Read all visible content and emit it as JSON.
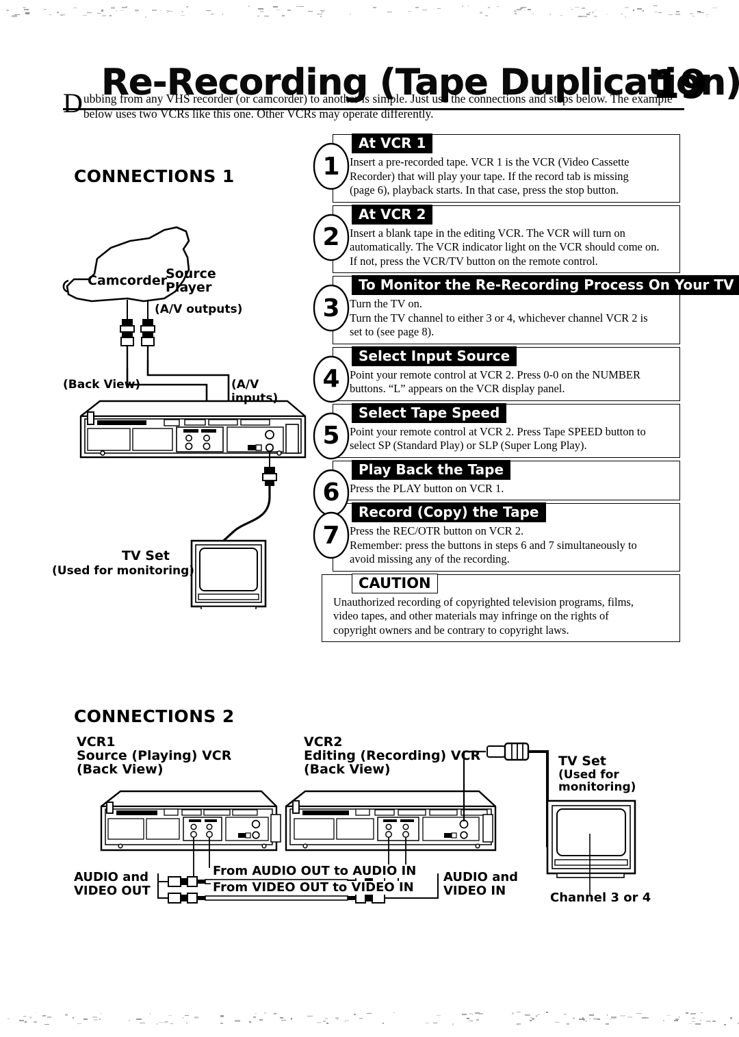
{
  "header": {
    "title": "Re-Recording (Tape Duplication)",
    "page_number": "19"
  },
  "intro": {
    "dropcap": "D",
    "text": "ubbing from any VHS recorder (or camcorder) to another is simple. Just use the connections and steps below. The example below uses two VCRs like this one. Other VCRs may operate differently."
  },
  "sections": {
    "connections1_title": "CONNECTIONS 1",
    "connections2_title": "CONNECTIONS 2"
  },
  "steps": [
    {
      "number": "1",
      "heading": "At VCR 1",
      "lines": [
        "Insert a pre-recorded tape. VCR 1 is the VCR (Video Cassette",
        "Recorder) that will play your tape. If the record tab is missing",
        "(page 6), playback starts. In that case, press the stop button."
      ]
    },
    {
      "number": "2",
      "heading": "At VCR 2",
      "lines": [
        "Insert a blank tape in the editing VCR. The VCR will turn on",
        "automatically. The VCR indicator light on the VCR should come on.",
        "If not, press the VCR/TV button on the remote control."
      ]
    },
    {
      "number": "3",
      "heading": "To Monitor the Re-Recording Process On Your TV",
      "lines": [
        "Turn the TV on.",
        "Turn the TV channel to either 3 or 4, whichever channel VCR 2 is",
        "set to (see page 8)."
      ]
    },
    {
      "number": "4",
      "heading": "Select Input Source",
      "lines": [
        "Point your remote control at VCR 2. Press 0-0 on the NUMBER",
        "buttons. “L” appears on the VCR display panel."
      ]
    },
    {
      "number": "5",
      "heading": "Select Tape Speed",
      "lines": [
        "Point your remote control at VCR 2. Press Tape SPEED button to",
        "select SP (Standard Play) or SLP (Super Long Play)."
      ]
    },
    {
      "number": "6",
      "heading": "Play Back the Tape",
      "lines": [
        "Press the PLAY button on VCR 1."
      ]
    },
    {
      "number": "7",
      "heading": "Record (Copy) the Tape",
      "lines": [
        "Press the REC/OTR button on VCR 2.",
        "Remember: press the buttons in steps 6 and 7 simultaneously to",
        "avoid missing any of the recording."
      ]
    }
  ],
  "caution": {
    "heading": "CAUTION",
    "lines": [
      "Unauthorized recording of copyrighted television programs, films,",
      "video tapes, and other materials may infringe on the rights of",
      "copyright owners and be contrary to copyright laws."
    ]
  },
  "connections1": {
    "camcorder_label": "Camcorder",
    "source_player_line1": "Source",
    "source_player_line2": "Player",
    "av_outputs": "(A/V outputs)",
    "back_view": "(Back View)",
    "av_inputs": "(A/V inputs)",
    "tv_set": "TV Set",
    "tv_monitoring": "(Used for monitoring)"
  },
  "connections2": {
    "vcr1_line1": "VCR1",
    "vcr1_line2": "Source (Playing) VCR",
    "vcr1_line3": "(Back View)",
    "vcr2_line1": "VCR2",
    "vcr2_line2": "Editing (Recording) VCR",
    "vcr2_line3": "(Back View)",
    "tv_set": "TV Set",
    "tv_used_for": "(Used for",
    "tv_monitoring": "monitoring)",
    "audio_video_out_1": "AUDIO and",
    "audio_video_out_2": "VIDEO OUT",
    "audio_video_in_1": "AUDIO and",
    "audio_video_in_2": "VIDEO IN",
    "cable_audio": "From AUDIO OUT to AUDIO IN",
    "cable_video": "From VIDEO OUT to VIDEO IN",
    "channel": "Channel 3 or 4"
  },
  "colors": {
    "ink": "#000000",
    "paper": "#ffffff"
  }
}
